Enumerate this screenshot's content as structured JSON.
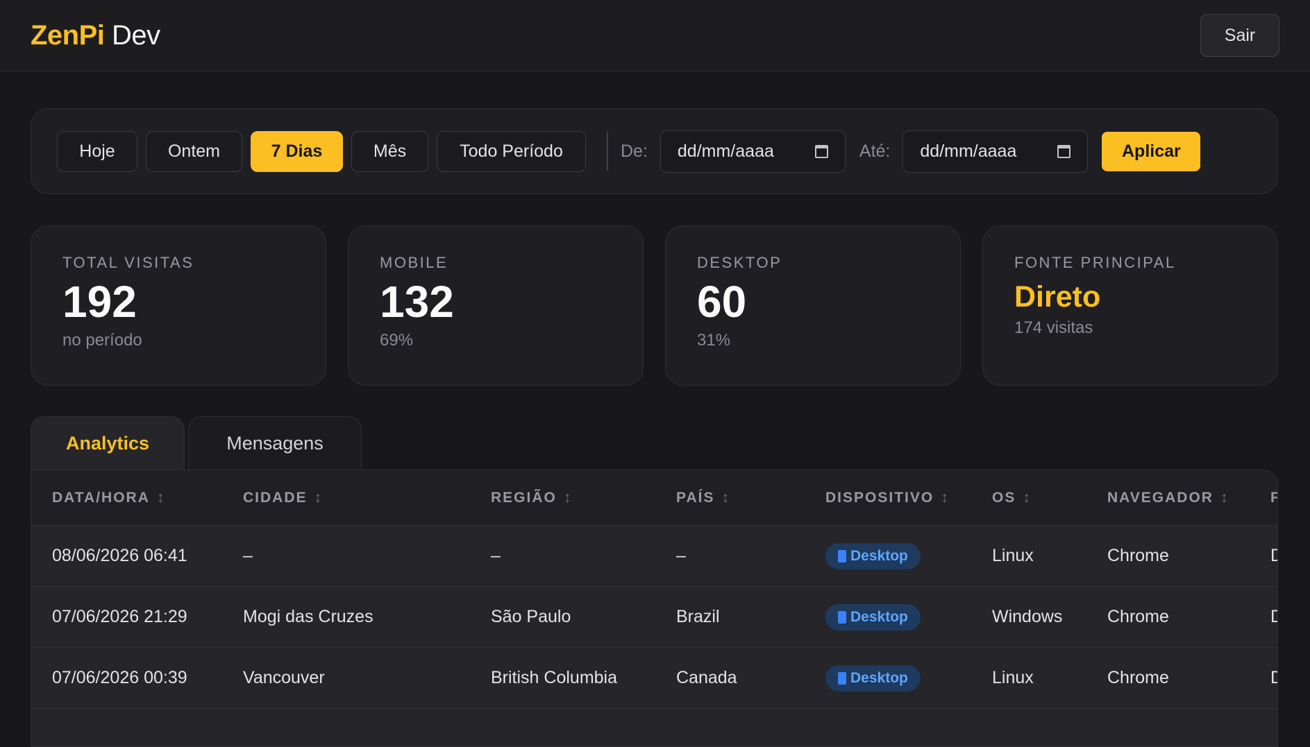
{
  "header": {
    "brand_main": "ZenPi",
    "brand_sub": " Dev",
    "logout_label": "Sair"
  },
  "filters": {
    "presets": [
      "Hoje",
      "Ontem",
      "7 Dias",
      "Mês",
      "Todo Período"
    ],
    "active_preset": "7 Dias",
    "from_label": "De:",
    "from_value": "dd/mm/aaaa",
    "to_label": "Até:",
    "to_value": "dd/mm/aaaa",
    "apply_label": "Aplicar"
  },
  "cards": [
    {
      "label": "TOTAL VISITAS",
      "value": "192",
      "sub": "no período"
    },
    {
      "label": "MOBILE",
      "value": "132",
      "sub": "69%"
    },
    {
      "label": "DESKTOP",
      "value": "60",
      "sub": "31%"
    },
    {
      "label": "FONTE PRINCIPAL",
      "value": "Direto",
      "sub": "174 visitas"
    }
  ],
  "tabs": [
    {
      "label": "Analytics"
    },
    {
      "label": "Mensagens"
    }
  ],
  "table": {
    "columns": [
      "DATA/HORA",
      "CIDADE",
      "REGIÃO",
      "PAÍS",
      "DISPOSITIVO",
      "OS",
      "NAVEGADOR",
      "F"
    ],
    "sort_glyph": "↕",
    "rows": [
      {
        "datetime": "08/06/2026 06:41",
        "city": "–",
        "region": "–",
        "country": "–",
        "device": "Desktop",
        "os": "Linux",
        "browser": "Chrome",
        "extra": "D"
      },
      {
        "datetime": "07/06/2026 21:29",
        "city": "Mogi das Cruzes",
        "region": "São Paulo",
        "country": "Brazil",
        "device": "Desktop",
        "os": "Windows",
        "browser": "Chrome",
        "extra": "D"
      },
      {
        "datetime": "07/06/2026 00:39",
        "city": "Vancouver",
        "region": "British Columbia",
        "country": "Canada",
        "device": "Desktop",
        "os": "Linux",
        "browser": "Chrome",
        "extra": "D"
      }
    ]
  },
  "colors": {
    "accent": "#fbbf24",
    "background": "#18181b",
    "badge_bg": "#1e3a5f",
    "badge_text": "#60a5fa"
  },
  "icons": {
    "date_picker": "calendar-icon",
    "device": "desktop-icon",
    "sort": "sort-icon"
  }
}
